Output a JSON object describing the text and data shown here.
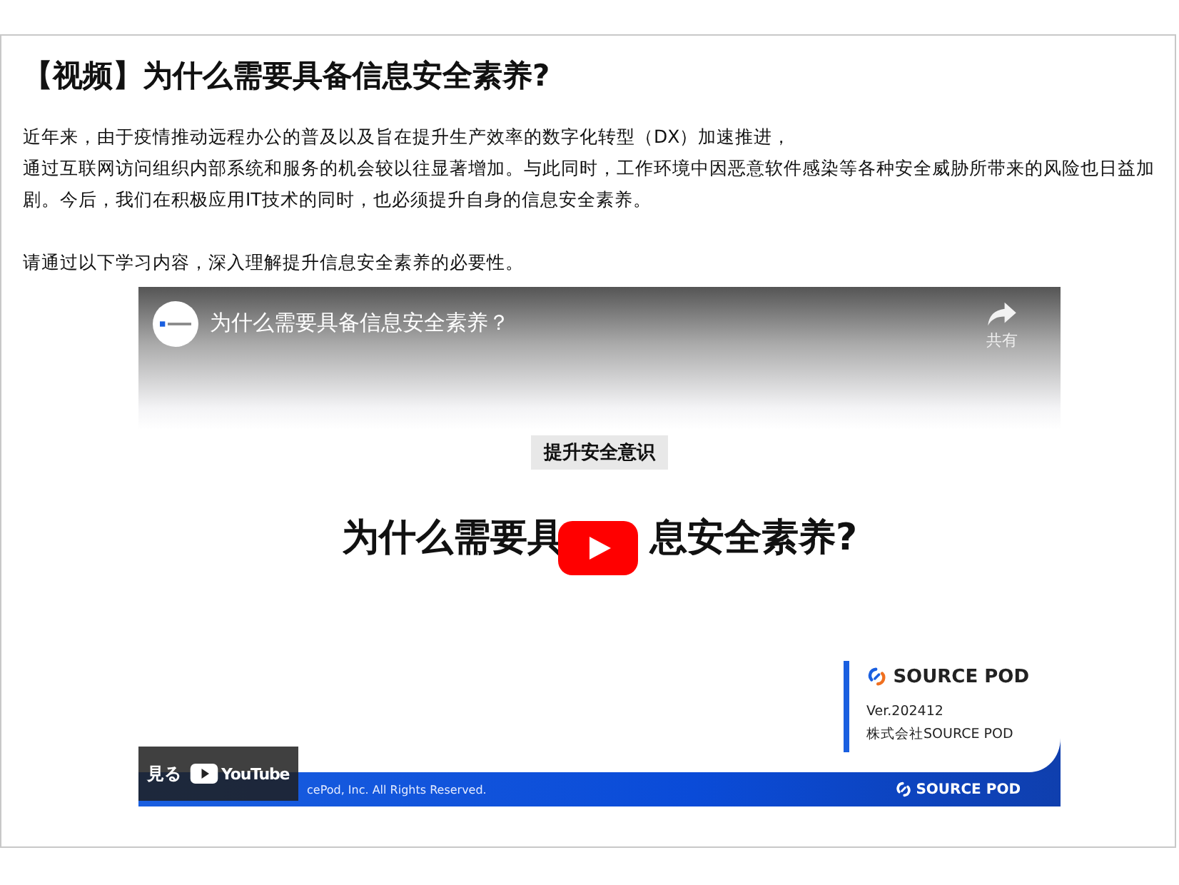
{
  "article": {
    "title": "【视频】为什么需要具备信息安全素养?",
    "paragraphs": [
      [
        "近年来，由于疫情推动远程办公的普及以及旨在提升生产效率的数字化转型（DX）加速推进，",
        "通过互联网访问组织内部系统和服务的机会较以往显著增加。与此同时，工作环境中因恶意软件感染等各种安全威胁所带来的风险也日益加剧。今后，我们在积极应用IT技术的同时，也必须提升自身的信息安全素养。"
      ],
      [
        "请通过以下学习内容，深入理解提升信息安全素养的必要性。"
      ]
    ]
  },
  "video": {
    "title": "为什么需要具备信息安全素养？",
    "share_label": "共有",
    "watch_label": "見る",
    "platform": "YouTube",
    "slide": {
      "tag": "提升安全意识",
      "heading_parts": [
        "为什么需要具",
        "息安全素养?"
      ],
      "brand": "SOURCE POD",
      "version": "Ver.202412",
      "company": "株式会社SOURCE POD",
      "copyright": "cePod, Inc. All Rights Reserved.",
      "footer_brand": "SOURCE POD"
    }
  }
}
